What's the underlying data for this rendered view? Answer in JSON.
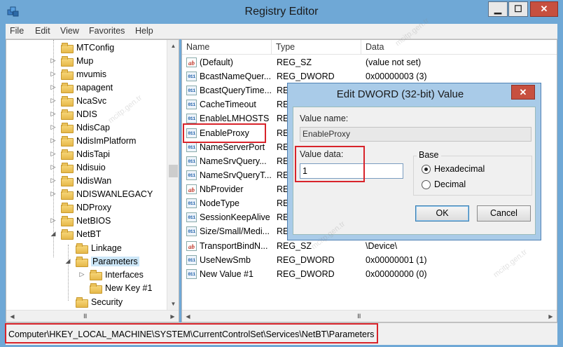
{
  "window": {
    "title": "Registry Editor",
    "min_glyph": "▁",
    "max_glyph": "☐",
    "close_glyph": "✕"
  },
  "menu": [
    {
      "label": "File"
    },
    {
      "label": "Edit"
    },
    {
      "label": "View"
    },
    {
      "label": "Favorites"
    },
    {
      "label": "Help"
    }
  ],
  "tree": {
    "items": [
      {
        "label": "MTConfig",
        "expander": "",
        "selected": false
      },
      {
        "label": "Mup",
        "expander": "▷",
        "selected": false
      },
      {
        "label": "mvumis",
        "expander": "▷",
        "selected": false
      },
      {
        "label": "napagent",
        "expander": "▷",
        "selected": false
      },
      {
        "label": "NcaSvc",
        "expander": "▷",
        "selected": false
      },
      {
        "label": "NDIS",
        "expander": "▷",
        "selected": false
      },
      {
        "label": "NdisCap",
        "expander": "▷",
        "selected": false
      },
      {
        "label": "NdisImPlatform",
        "expander": "▷",
        "selected": false
      },
      {
        "label": "NdisTapi",
        "expander": "▷",
        "selected": false
      },
      {
        "label": "Ndisuio",
        "expander": "▷",
        "selected": false
      },
      {
        "label": "NdisWan",
        "expander": "▷",
        "selected": false
      },
      {
        "label": "NDISWANLEGACY",
        "expander": "▷",
        "selected": false
      },
      {
        "label": "NDProxy",
        "expander": "",
        "selected": false
      },
      {
        "label": "NetBIOS",
        "expander": "▷",
        "selected": false
      },
      {
        "label": "NetBT",
        "expander": "◢",
        "selected": false
      },
      {
        "label": "Linkage",
        "expander": "",
        "selected": false
      },
      {
        "label": "Parameters",
        "expander": "◢",
        "selected": true
      },
      {
        "label": "Interfaces",
        "expander": "▷",
        "selected": false
      },
      {
        "label": "New Key #1",
        "expander": "",
        "selected": false
      },
      {
        "label": "Security",
        "expander": "",
        "selected": false
      }
    ],
    "scroll_up_glyph": "▲",
    "scroll_down_glyph": "▼",
    "scroll_left_glyph": "◀",
    "scroll_right_glyph": "▶",
    "grip_glyph": "III"
  },
  "list": {
    "columns": [
      {
        "label": "Name"
      },
      {
        "label": "Type"
      },
      {
        "label": "Data"
      }
    ],
    "rows": [
      {
        "name": "(Default)",
        "type": "REG_SZ",
        "data": "(value not set)",
        "icon": "sz"
      },
      {
        "name": "BcastNameQuer...",
        "type": "REG_DWORD",
        "data": "0x00000003 (3)",
        "icon": "dw"
      },
      {
        "name": "BcastQueryTime...",
        "type": "REG_DWORD",
        "data": "",
        "icon": "dw"
      },
      {
        "name": "CacheTimeout",
        "type": "REG_DWORD",
        "data": "",
        "icon": "dw"
      },
      {
        "name": "EnableLMHOSTS",
        "type": "REG_DWORD",
        "data": "",
        "icon": "dw"
      },
      {
        "name": "EnableProxy",
        "type": "REG_DWORD",
        "data": "",
        "icon": "dw"
      },
      {
        "name": "NameServerPort",
        "type": "REG_DWORD",
        "data": "",
        "icon": "dw"
      },
      {
        "name": "NameSrvQuery...",
        "type": "REG_DWORD",
        "data": "",
        "icon": "dw"
      },
      {
        "name": "NameSrvQueryT...",
        "type": "REG_DWORD",
        "data": "",
        "icon": "dw"
      },
      {
        "name": "NbProvider",
        "type": "REG_SZ",
        "data": "",
        "icon": "sz"
      },
      {
        "name": "NodeType",
        "type": "REG_DWORD",
        "data": "",
        "icon": "dw"
      },
      {
        "name": "SessionKeepAlive",
        "type": "REG_DWORD",
        "data": "",
        "icon": "dw"
      },
      {
        "name": "Size/Small/Medi...",
        "type": "REG_DWORD",
        "data": "",
        "icon": "dw"
      },
      {
        "name": "TransportBindN...",
        "type": "REG_SZ",
        "data": "\\Device\\",
        "icon": "sz"
      },
      {
        "name": "UseNewSmb",
        "type": "REG_DWORD",
        "data": "0x00000001 (1)",
        "icon": "dw"
      },
      {
        "name": "New Value #1",
        "type": "REG_DWORD",
        "data": "0x00000000 (0)",
        "icon": "dw"
      }
    ],
    "type_prefix_clipped": "RE",
    "icon_text_sz": "ab",
    "icon_text_dw": "011"
  },
  "status": {
    "path": "Computer\\HKEY_LOCAL_MACHINE\\SYSTEM\\CurrentControlSet\\Services\\NetBT\\Parameters"
  },
  "dialog": {
    "title": "Edit DWORD (32-bit) Value",
    "close_glyph": "✕",
    "value_name_label": "Value name:",
    "value_name": "EnableProxy",
    "value_data_label": "Value data:",
    "value_data": "1",
    "base_label": "Base",
    "base_options": [
      {
        "label": "Hexadecimal",
        "selected": true
      },
      {
        "label": "Decimal",
        "selected": false
      }
    ],
    "ok_label": "OK",
    "cancel_label": "Cancel"
  },
  "watermark": "mcitp.gen.tr",
  "colors": {
    "highlight_red": "#d8232a",
    "title_bar": "#6fa8d6",
    "close_red": "#c7503f"
  }
}
